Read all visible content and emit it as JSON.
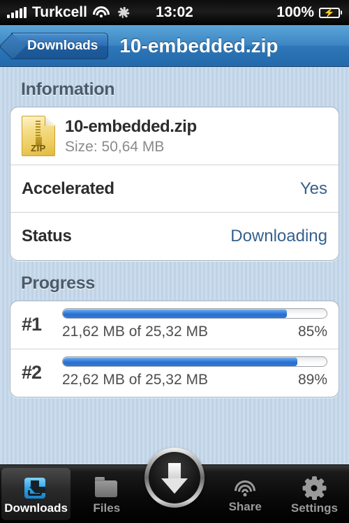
{
  "status_bar": {
    "signal_icon": "signal-bars-icon",
    "carrier": "Turkcell",
    "wifi_icon": "wifi-icon",
    "activity_icon": "activity-spinner-icon",
    "time": "13:02",
    "battery_percent": "100%",
    "battery_icon": "battery-charging-icon"
  },
  "nav_bar": {
    "back_label": "Downloads",
    "title": "10-embedded.zip"
  },
  "sections": {
    "information": {
      "header": "Information",
      "file": {
        "icon": "zip-file-icon",
        "icon_label": "ZIP",
        "name": "10-embedded.zip",
        "size": "Size: 50,64 MB"
      },
      "rows": [
        {
          "label": "Accelerated",
          "value": "Yes"
        },
        {
          "label": "Status",
          "value": "Downloading"
        }
      ]
    },
    "progress": {
      "header": "Progress",
      "items": [
        {
          "number": "#1",
          "detail": "21,62 MB of 25,32 MB",
          "percent_label": "85%",
          "percent": 85
        },
        {
          "number": "#2",
          "detail": "22,62 MB of 25,32 MB",
          "percent_label": "89%",
          "percent": 89
        }
      ]
    }
  },
  "tab_bar": {
    "items": [
      {
        "label": "Downloads",
        "icon": "downloads-tray-icon",
        "active": true
      },
      {
        "label": "Files",
        "icon": "folder-icon",
        "active": false
      },
      {
        "label": "Share",
        "icon": "wifi-share-icon",
        "active": false
      },
      {
        "label": "Settings",
        "icon": "gear-icon",
        "active": false
      }
    ],
    "center_button": {
      "icon": "download-arrow-icon"
    }
  },
  "colors": {
    "accent_blue": "#36618e",
    "progress_fill": "#2e78d8",
    "nav_blue": "#3c86c4",
    "background": "#c4d5e6",
    "section_header": "#4b5b6b"
  }
}
